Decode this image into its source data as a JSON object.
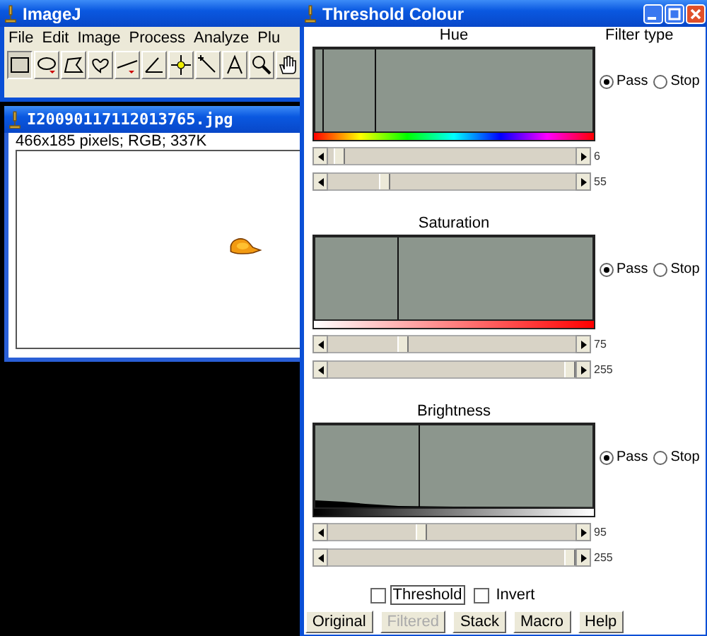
{
  "imagej": {
    "title": "ImageJ",
    "menu": [
      "File",
      "Edit",
      "Image",
      "Process",
      "Analyze",
      "Plu"
    ],
    "tools": [
      {
        "kind": "rectangle",
        "selected": true
      },
      {
        "kind": "oval",
        "selected": false
      },
      {
        "kind": "polygon",
        "selected": false
      },
      {
        "kind": "freehand",
        "selected": false
      },
      {
        "kind": "line",
        "selected": false
      },
      {
        "kind": "angle",
        "selected": false
      },
      {
        "kind": "point",
        "selected": false
      },
      {
        "kind": "wand",
        "selected": false
      },
      {
        "kind": "text",
        "selected": false
      },
      {
        "kind": "zoom",
        "selected": false
      },
      {
        "kind": "hand",
        "selected": false
      }
    ]
  },
  "image_window": {
    "title": "I20090117112013765.jpg",
    "info": "466x185 pixels; RGB; 337K"
  },
  "threshold": {
    "title": "Threshold  Colour",
    "filter_type_label": "Filter type",
    "channels": [
      {
        "kind": "hue",
        "name": "Hue",
        "options": [
          {
            "label": "Pass",
            "selected": true
          },
          {
            "label": "Stop",
            "selected": false
          }
        ],
        "sliders": [
          {
            "level": 0.024,
            "reading": "6"
          },
          {
            "level": 0.216,
            "reading": "55"
          }
        ]
      },
      {
        "kind": "saturation",
        "name": "Saturation",
        "options": [
          {
            "label": "Pass",
            "selected": true
          },
          {
            "label": "Stop",
            "selected": false
          }
        ],
        "sliders": [
          {
            "level": 0.294,
            "reading": "75"
          },
          {
            "level": 1.0,
            "reading": "255"
          }
        ]
      },
      {
        "kind": "brightness",
        "name": "Brightness",
        "options": [
          {
            "label": "Pass",
            "selected": true
          },
          {
            "label": "Stop",
            "selected": false
          }
        ],
        "sliders": [
          {
            "level": 0.373,
            "reading": "95"
          },
          {
            "level": 1.0,
            "reading": "255"
          }
        ]
      }
    ],
    "checkboxes": [
      {
        "label": "Threshold",
        "checked": false,
        "focused": true
      },
      {
        "label": "Invert",
        "checked": false,
        "focused": false
      }
    ],
    "buttons": [
      {
        "label": "Original",
        "disabled": false
      },
      {
        "label": "Filtered",
        "disabled": true
      },
      {
        "label": "Stack",
        "disabled": false
      },
      {
        "label": "Macro",
        "disabled": false
      },
      {
        "label": "Help",
        "disabled": false
      }
    ]
  }
}
